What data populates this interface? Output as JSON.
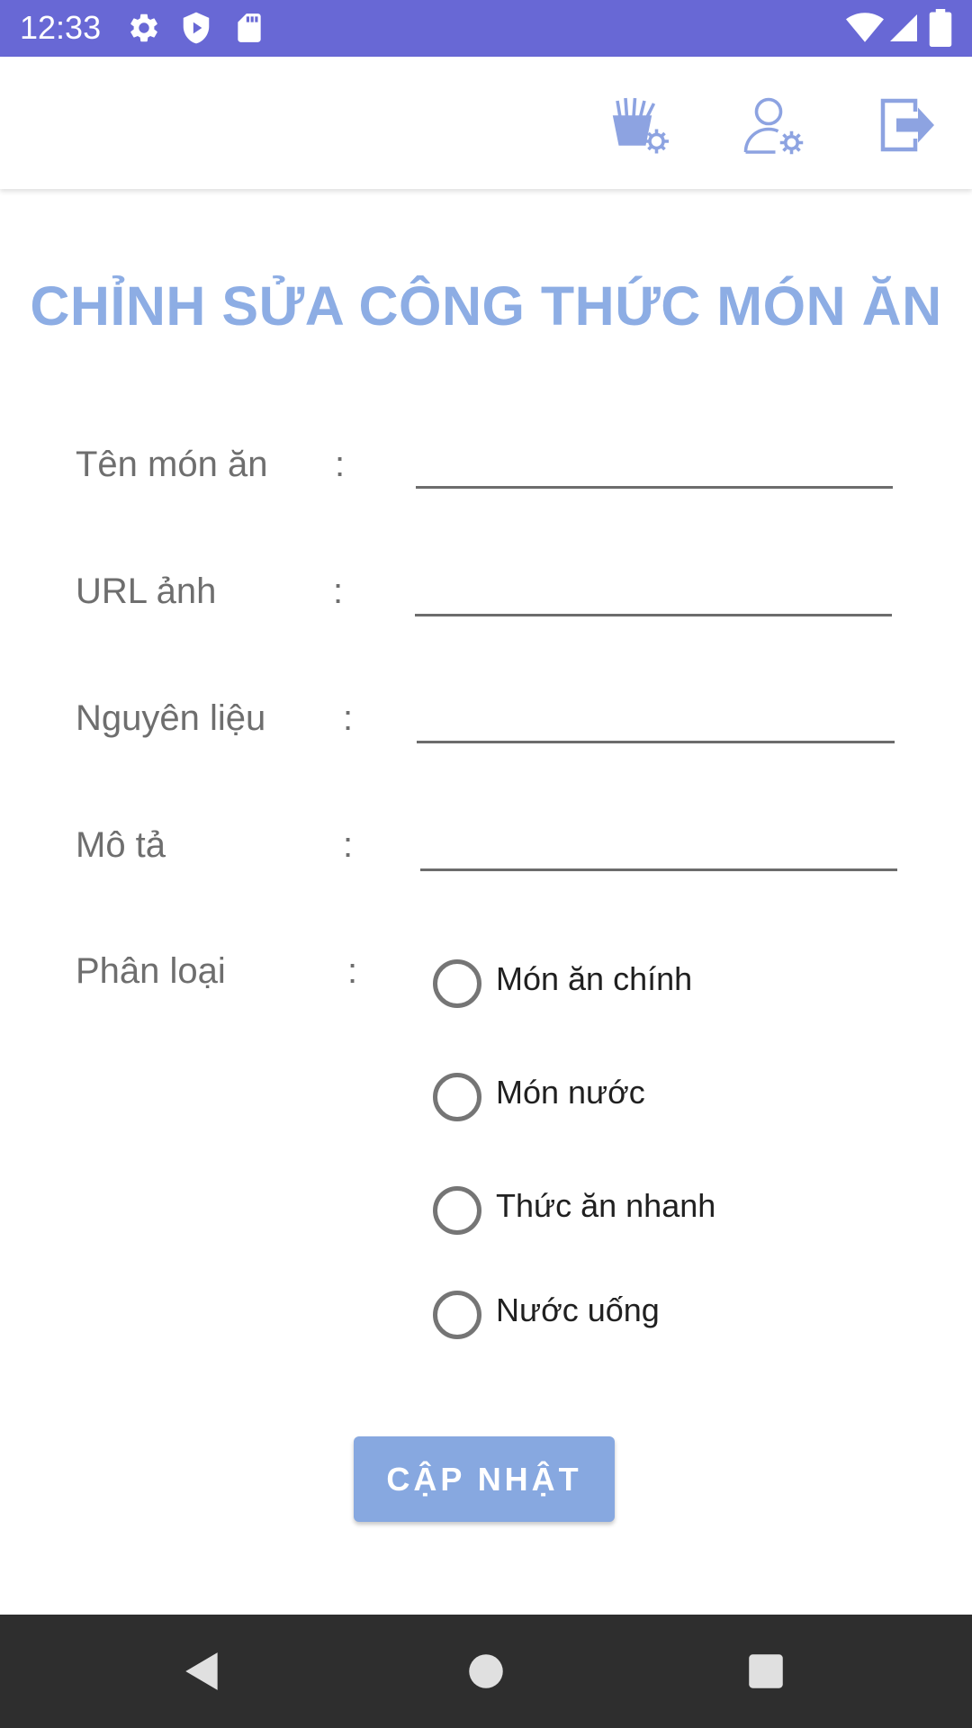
{
  "status_bar": {
    "time": "12:33",
    "left_icons": [
      "settings-icon",
      "shield-play-icon",
      "sd-card-icon"
    ],
    "right_icons": [
      "wifi-icon",
      "signal-icon",
      "battery-icon"
    ],
    "background": "#6868d5"
  },
  "app_bar": {
    "actions": [
      "food-settings-icon",
      "user-settings-icon",
      "logout-icon"
    ],
    "icon_color": "#8da3e1"
  },
  "page": {
    "title": "CHỈNH SỬA CÔNG THỨC MÓN ĂN",
    "title_color": "#8dade4"
  },
  "form": {
    "name_label": "Tên món ăn",
    "name_value": "",
    "image_url_label": "URL ảnh",
    "image_url_value": "",
    "ingredients_label": "Nguyên liệu",
    "ingredients_value": "",
    "description_label": "Mô tả",
    "description_value": "",
    "category_label": "Phân loại",
    "colon": ":",
    "category_options": [
      {
        "label": "Món ăn chính",
        "selected": false
      },
      {
        "label": "Món nước",
        "selected": false
      },
      {
        "label": "Thức ăn nhanh",
        "selected": false
      },
      {
        "label": "Nước uống",
        "selected": false
      }
    ],
    "submit_label": "CẬP NHẬT",
    "submit_color": "#87a8e0"
  },
  "nav_bar": {
    "buttons": [
      "back-icon",
      "home-icon",
      "recents-icon"
    ]
  }
}
